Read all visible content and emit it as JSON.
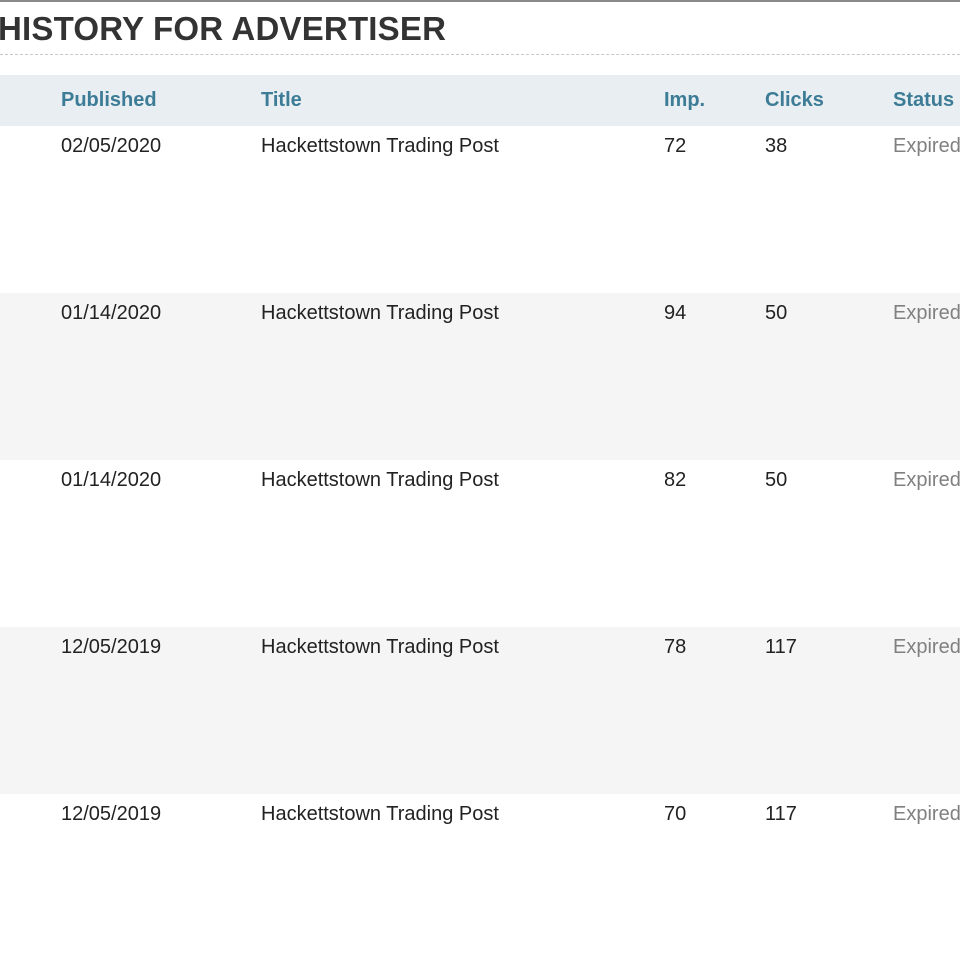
{
  "page": {
    "title": "HISTORY FOR ADVERTISER"
  },
  "table": {
    "columns": {
      "published": "Published",
      "title": "Title",
      "imp": "Imp.",
      "clicks": "Clicks",
      "status": "Status"
    },
    "rows": [
      {
        "published": "02/05/2020",
        "title": "Hackettstown Trading Post",
        "imp": "72",
        "clicks": "38",
        "status": "Expired"
      },
      {
        "published": "01/14/2020",
        "title": "Hackettstown Trading Post",
        "imp": "94",
        "clicks": "50",
        "status": "Expired"
      },
      {
        "published": "01/14/2020",
        "title": "Hackettstown Trading Post",
        "imp": "82",
        "clicks": "50",
        "status": "Expired"
      },
      {
        "published": "12/05/2019",
        "title": "Hackettstown Trading Post",
        "imp": "78",
        "clicks": "117",
        "status": "Expired"
      },
      {
        "published": "12/05/2019",
        "title": "Hackettstown Trading Post",
        "imp": "70",
        "clicks": "117",
        "status": "Expired"
      }
    ]
  },
  "colors": {
    "header_text": "#3d7c96",
    "header_bg": "#e8eef1",
    "alt_row_bg": "#f5f5f5",
    "status_text": "#808080"
  }
}
